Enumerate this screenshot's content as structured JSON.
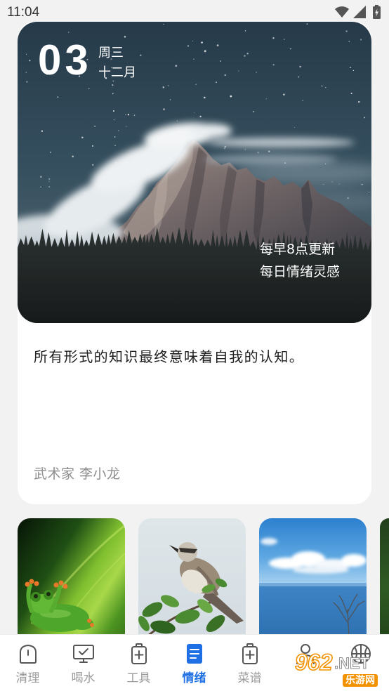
{
  "status_bar": {
    "time": "11:04",
    "icons": [
      "wifi-icon",
      "signal-icon",
      "battery-charging-icon"
    ]
  },
  "daily_card": {
    "date": {
      "day": "03",
      "weekday": "周三",
      "month": "十二月"
    },
    "caption": [
      "每早8点更新",
      "每日情绪灵感"
    ],
    "quote": "所有形式的知识最终意味着自我的认知。",
    "author": "武术家 李小龙"
  },
  "nav": {
    "items": [
      {
        "label": "清理",
        "icon": "clean-icon"
      },
      {
        "label": "喝水",
        "icon": "monitor-check-icon"
      },
      {
        "label": "工具",
        "icon": "battery-plus-icon"
      },
      {
        "label": "情绪",
        "icon": "document-icon",
        "active": true
      },
      {
        "label": "菜谱",
        "icon": "battery-plus-icon"
      },
      {
        "icon": "person-icon"
      },
      {
        "icon": "ball-icon"
      }
    ]
  },
  "watermark": {
    "number": "962",
    "suffix": ".NET",
    "name": "乐游网"
  },
  "colors": {
    "background": "#f2f2f2",
    "card": "#ffffff",
    "accent": "#1f6fe5",
    "nav_inactive": "#9c9c9c",
    "quote_text": "#1f1f1f",
    "author_text": "#8d8d8d",
    "watermark_orange": "#f39200"
  }
}
